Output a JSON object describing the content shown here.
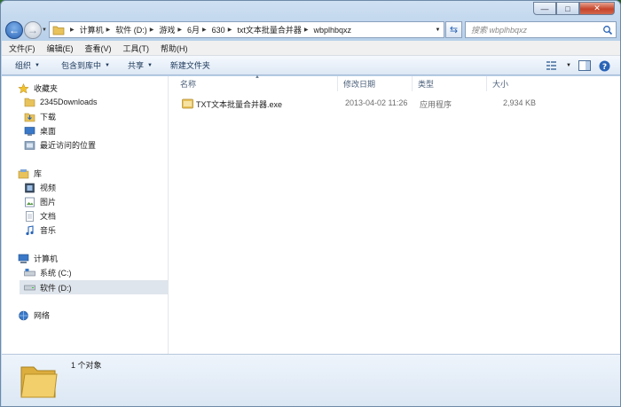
{
  "window": {
    "caption_buttons": {
      "minimize": "—",
      "maximize": "□",
      "close": "✕"
    }
  },
  "address": {
    "breadcrumbs": [
      "计算机",
      "软件 (D:)",
      "游戏",
      "6月",
      "630",
      "txt文本批量合并器",
      "wbplhbqxz"
    ],
    "search_placeholder": "搜索 wbplhbqxz",
    "refresh_glyph": "⇆"
  },
  "menu": [
    "文件(F)",
    "编辑(E)",
    "查看(V)",
    "工具(T)",
    "帮助(H)"
  ],
  "toolbar": {
    "organize": "组织",
    "include_in_library": "包含到库中",
    "share": "共享",
    "new_folder": "新建文件夹"
  },
  "nav": {
    "favorites": "收藏夹",
    "favorites_items": [
      "2345Downloads",
      "下载",
      "桌面",
      "最近访问的位置"
    ],
    "libraries": "库",
    "libraries_items": [
      "视频",
      "图片",
      "文档",
      "音乐"
    ],
    "computer": "计算机",
    "computer_items": [
      "系统 (C:)",
      "软件 (D:)"
    ],
    "network": "网络"
  },
  "columns": {
    "name": "名称",
    "modified": "修改日期",
    "type": "类型",
    "size": "大小"
  },
  "files": [
    {
      "name": "TXT文本批量合并器.exe",
      "modified": "2013-04-02 11:26",
      "type": "应用程序",
      "size": "2,934 KB"
    }
  ],
  "details": {
    "count": "1 个对象"
  },
  "colors": {
    "accent": "#2a64b6",
    "folder": "#e8c25a"
  }
}
